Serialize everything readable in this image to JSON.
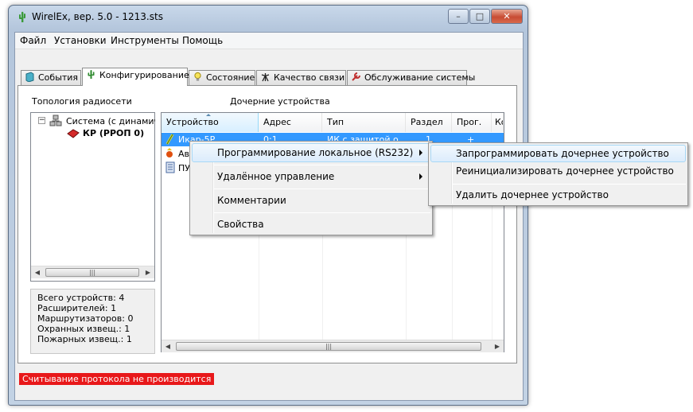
{
  "window": {
    "title": "WirelEx, вер. 5.0 - 1213.sts",
    "minimize": "–",
    "maximize": "□",
    "close": "✕"
  },
  "menubar": [
    "Файл",
    "Установки",
    "Инструменты",
    "Помощь"
  ],
  "tabs": [
    {
      "label": "События",
      "icon": "book-icon",
      "active": false
    },
    {
      "label": "Конфигурирование",
      "icon": "cactus-icon",
      "active": true
    },
    {
      "label": "Состояние",
      "icon": "lightbulb-icon",
      "active": false
    },
    {
      "label": "Качество связи",
      "icon": "antenna-icon",
      "active": false
    },
    {
      "label": "Обслуживание системы",
      "icon": "wrench-icon",
      "active": false
    }
  ],
  "topology": {
    "title": "Топология радиосети",
    "root": "Система (с динамичес",
    "child": "КР (РРОП 0)"
  },
  "stats": {
    "total": "Всего устройств: 4",
    "extenders": "Расширителей: 1",
    "routers": "Маршрутизаторов: 0",
    "security": "Охранных извещ.: 1",
    "fire": "Пожарных извещ.: 1"
  },
  "devices": {
    "title": "Дочерние устройства",
    "columns": [
      "Устройство",
      "Адрес",
      "Тип",
      "Раздел",
      "Прог.",
      "Ко"
    ],
    "rows": [
      {
        "device": "Икар-5Р",
        "address": "0:1",
        "type": "ИК с защитой о...",
        "section": "1",
        "prog": "+"
      },
      {
        "device": "Ав",
        "address": "",
        "type": "",
        "section": "",
        "prog": ""
      },
      {
        "device": "ПУ",
        "address": "",
        "type": "",
        "section": "",
        "prog": ""
      }
    ]
  },
  "context_menu": {
    "items": [
      "Программирование локальное (RS232)",
      "Удалённое управление",
      "Комментарии",
      "Свойства"
    ]
  },
  "submenu": {
    "items": [
      "Запрограммировать дочернее устройство",
      "Реинициализировать дочернее устройство",
      "Удалить дочернее устройство"
    ]
  },
  "status": "Считывание протокола не производится",
  "colors": {
    "accent": "#3399ff",
    "status_bg": "#e8181a"
  }
}
